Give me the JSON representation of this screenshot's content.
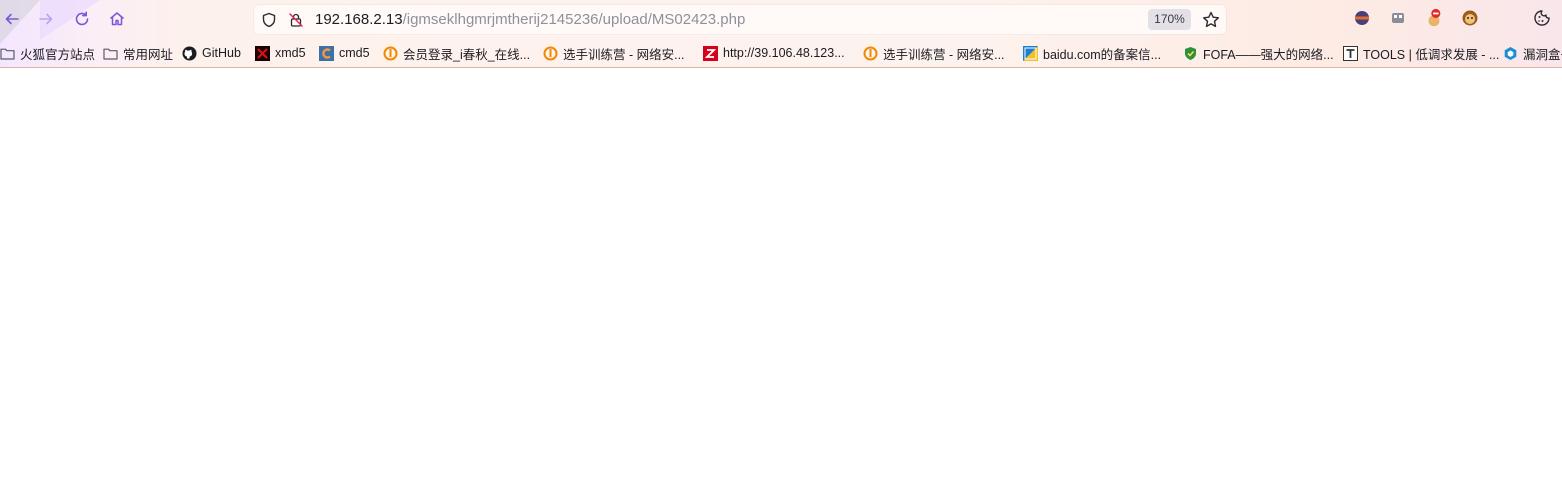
{
  "toolbar": {
    "back_icon": "arrow-left-icon",
    "forward_icon": "arrow-right-icon",
    "reload_icon": "reload-icon",
    "home_icon": "home-icon"
  },
  "urlbar": {
    "host": "192.168.2.13",
    "path": "/igmseklhgmrjmtherij2145236/upload/MS02423.php",
    "zoom": "170%",
    "shield_icon": "tracking-protection-shield-icon",
    "insecure_icon": "insecure-lock-icon",
    "bookmark_icon": "star-icon"
  },
  "extensions": [
    {
      "name": "extension-orb-icon"
    },
    {
      "name": "extension-container-icon"
    },
    {
      "name": "extension-badge-icon"
    },
    {
      "name": "extension-monkey-icon"
    },
    {
      "name": "cookie-icon"
    }
  ],
  "bookmarks": [
    {
      "label": "火狐官方站点",
      "icon": "folder-icon",
      "color": "#5b5b66"
    },
    {
      "label": "常用网址",
      "icon": "folder-icon",
      "color": "#5b5b66"
    },
    {
      "label": "GitHub",
      "icon": "github-icon",
      "color": "#1c1b22"
    },
    {
      "label": "xmd5",
      "icon": "xmd5-icon",
      "color": "#c00000"
    },
    {
      "label": "cmd5",
      "icon": "cmd5-icon",
      "color": "#e07b28"
    },
    {
      "label": "会员登录_i春秋_在线...",
      "icon": "ichunqiu-icon",
      "color": "#f08a00"
    },
    {
      "label": "选手训练营 - 网络安...",
      "icon": "ichunqiu-icon",
      "color": "#f08a00"
    },
    {
      "label": "http://39.106.48.123...",
      "icon": "z-icon",
      "color": "#d6001c"
    },
    {
      "label": "选手训练营 - 网络安...",
      "icon": "ichunqiu-icon",
      "color": "#f08a00"
    },
    {
      "label": "baidu.com的备案信...",
      "icon": "beian-icon",
      "color": "#1a7fd4"
    },
    {
      "label": "FOFA——强大的网络...",
      "icon": "fofa-icon",
      "color": "#2f8f3a"
    },
    {
      "label": "TOOLS | 低调求发展 - ...",
      "icon": "tools-icon",
      "color": "#333333"
    },
    {
      "label": "漏洞盒子",
      "icon": "hexagon-icon",
      "color": "#1a8fd6"
    }
  ]
}
